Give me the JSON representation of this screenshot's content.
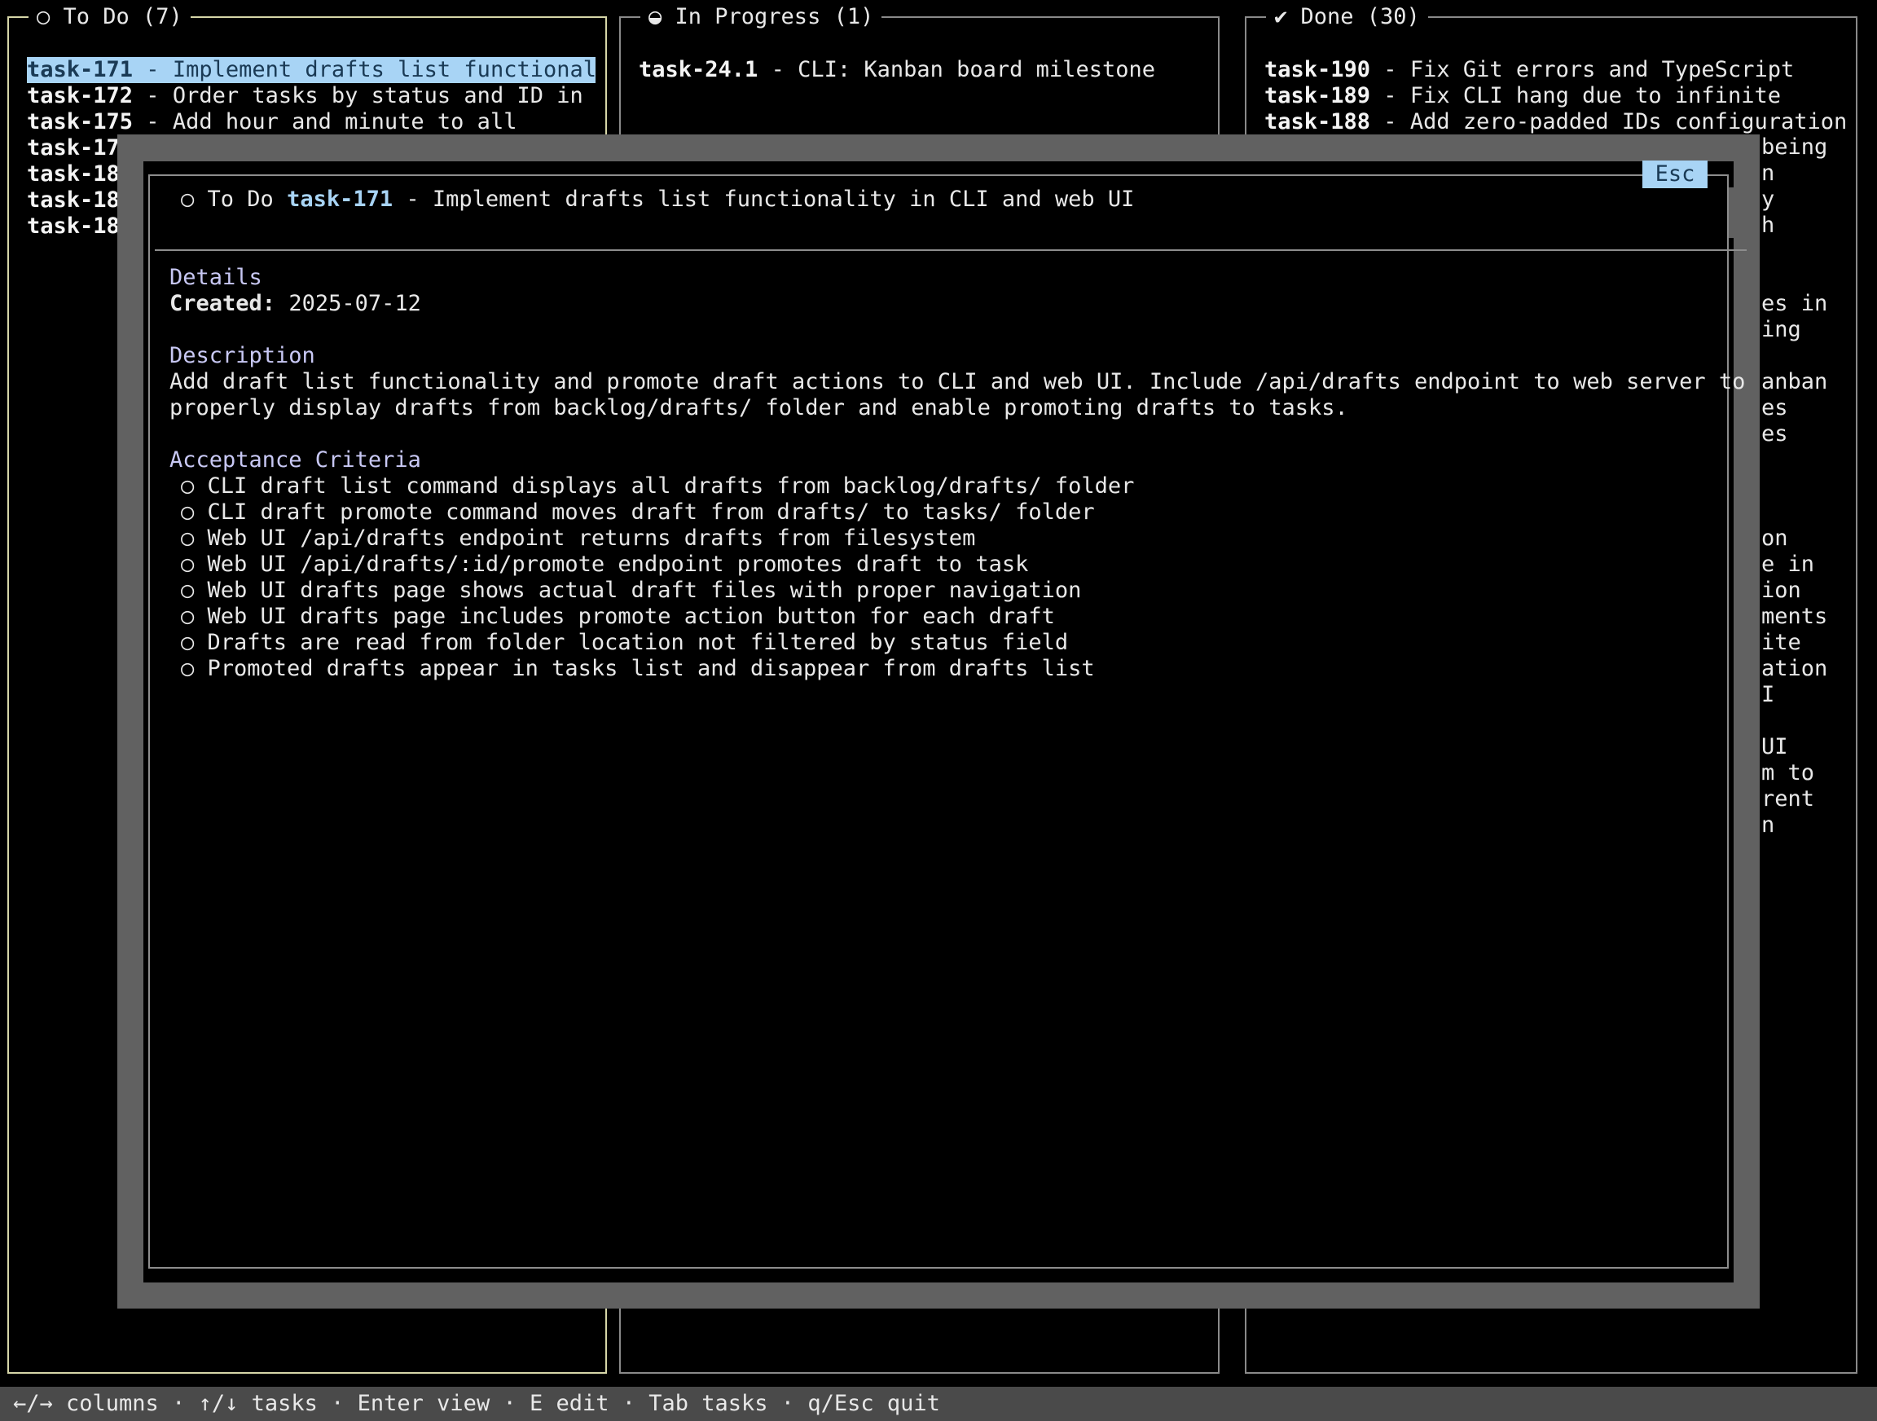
{
  "columns": {
    "todo": {
      "title": "○ To Do (7)",
      "rows": [
        {
          "id": "task-171",
          "text": " - Implement drafts list functional"
        },
        {
          "id": "task-172",
          "text": " - Order tasks by status and ID in"
        },
        {
          "id": "task-175",
          "text": " - Add hour and minute to all"
        },
        {
          "id": "task-17",
          "text": ""
        },
        {
          "id": "task-18",
          "text": ""
        },
        {
          "id": "task-18",
          "text": ""
        },
        {
          "id": "task-18",
          "text": ""
        }
      ]
    },
    "in_progress": {
      "title": "◒ In Progress (1)",
      "rows": [
        {
          "id": "task-24.1",
          "text": " - CLI: Kanban board milestone"
        }
      ]
    },
    "done": {
      "title": "✔ Done (30)",
      "rows": [
        {
          "id": "task-190",
          "text": " - Fix Git errors and TypeScript"
        },
        {
          "id": "task-189",
          "text": " - Fix CLI hang due to infinite"
        },
        {
          "id": "task-188",
          "text": " - Add zero-padded IDs configuration"
        }
      ],
      "fragments": [
        "being",
        "n",
        "y",
        "h",
        "es in",
        "ing",
        "anban",
        "es",
        "es",
        "on",
        "e in",
        "ion",
        "ments",
        "ite",
        "ation",
        "I",
        "UI",
        "m to",
        "rent",
        "n"
      ]
    }
  },
  "modal": {
    "esc_label": "Esc",
    "header": {
      "status_icon": "○",
      "status": "To Do",
      "task_id": "task-171",
      "title": " - Implement drafts list functionality in CLI and web UI"
    },
    "details": {
      "heading": "Details",
      "created_label": "Created:",
      "created_value": "2025-07-12"
    },
    "description": {
      "heading": "Description",
      "lines": [
        "Add draft list functionality and promote draft actions to CLI and web UI. Include /api/drafts endpoint to web server to",
        "properly display drafts from backlog/drafts/ folder and enable promoting drafts to tasks."
      ]
    },
    "acceptance": {
      "heading": "Acceptance Criteria",
      "items": [
        "○ CLI draft list command displays all drafts from backlog/drafts/ folder",
        "○ CLI draft promote command moves draft from drafts/ to tasks/ folder",
        "○ Web UI /api/drafts endpoint returns drafts from filesystem",
        "○ Web UI /api/drafts/:id/promote endpoint promotes draft to task",
        "○ Web UI drafts page shows actual draft files with proper navigation",
        "○ Web UI drafts page includes promote action button for each draft",
        "○ Drafts are read from folder location not filtered by status field",
        "○ Promoted drafts appear in tasks list and disappear from drafts list"
      ]
    }
  },
  "status_bar": {
    "text": "←/→ columns · ↑/↓ tasks · Enter view · E edit · Tab tasks · q/Esc quit"
  },
  "colors": {
    "selection": "#a8d4f5",
    "modal_border": "#616161",
    "section_heading": "#c8c8f4",
    "active_column_border": "#d6d6a8"
  }
}
